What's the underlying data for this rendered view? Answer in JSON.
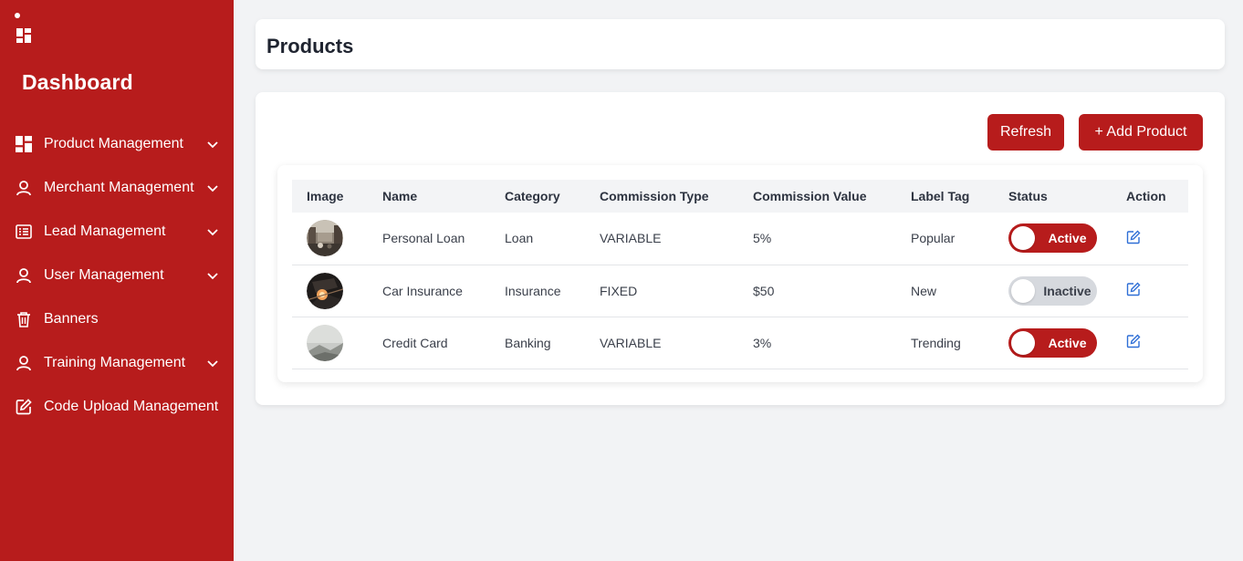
{
  "sidebar": {
    "title": "Dashboard",
    "items": [
      {
        "label": "Product Management",
        "icon": "grid-icon",
        "has_chevron": true
      },
      {
        "label": "Merchant Management",
        "icon": "user-icon",
        "has_chevron": true
      },
      {
        "label": "Lead Management",
        "icon": "list-icon",
        "has_chevron": true
      },
      {
        "label": "User Management",
        "icon": "user-icon",
        "has_chevron": true
      },
      {
        "label": "Banners",
        "icon": "trash-icon",
        "has_chevron": false
      },
      {
        "label": "Training Management",
        "icon": "user-icon",
        "has_chevron": true
      },
      {
        "label": "Code Upload Management",
        "icon": "edit-icon",
        "has_chevron": false
      }
    ]
  },
  "header": {
    "title": "Products"
  },
  "toolbar": {
    "refresh_label": "Refresh",
    "add_label": "+ Add Product"
  },
  "table": {
    "columns": [
      "Image",
      "Name",
      "Category",
      "Commission Type",
      "Commission Value",
      "Label Tag",
      "Status",
      "Action"
    ],
    "rows": [
      {
        "name": "Personal Loan",
        "category": "Loan",
        "commission_type": "VARIABLE",
        "commission_value": "5%",
        "label_tag": "Popular",
        "status": "Active"
      },
      {
        "name": "Car Insurance",
        "category": "Insurance",
        "commission_type": "FIXED",
        "commission_value": "$50",
        "label_tag": "New",
        "status": "Inactive"
      },
      {
        "name": "Credit Card",
        "category": "Banking",
        "commission_type": "VARIABLE",
        "commission_value": "3%",
        "label_tag": "Trending",
        "status": "Active"
      }
    ]
  },
  "colors": {
    "brand": "#b71c1c",
    "background": "#f2f3f5",
    "edit_icon": "#2f6fd6",
    "inactive_toggle": "#d6d9de"
  }
}
